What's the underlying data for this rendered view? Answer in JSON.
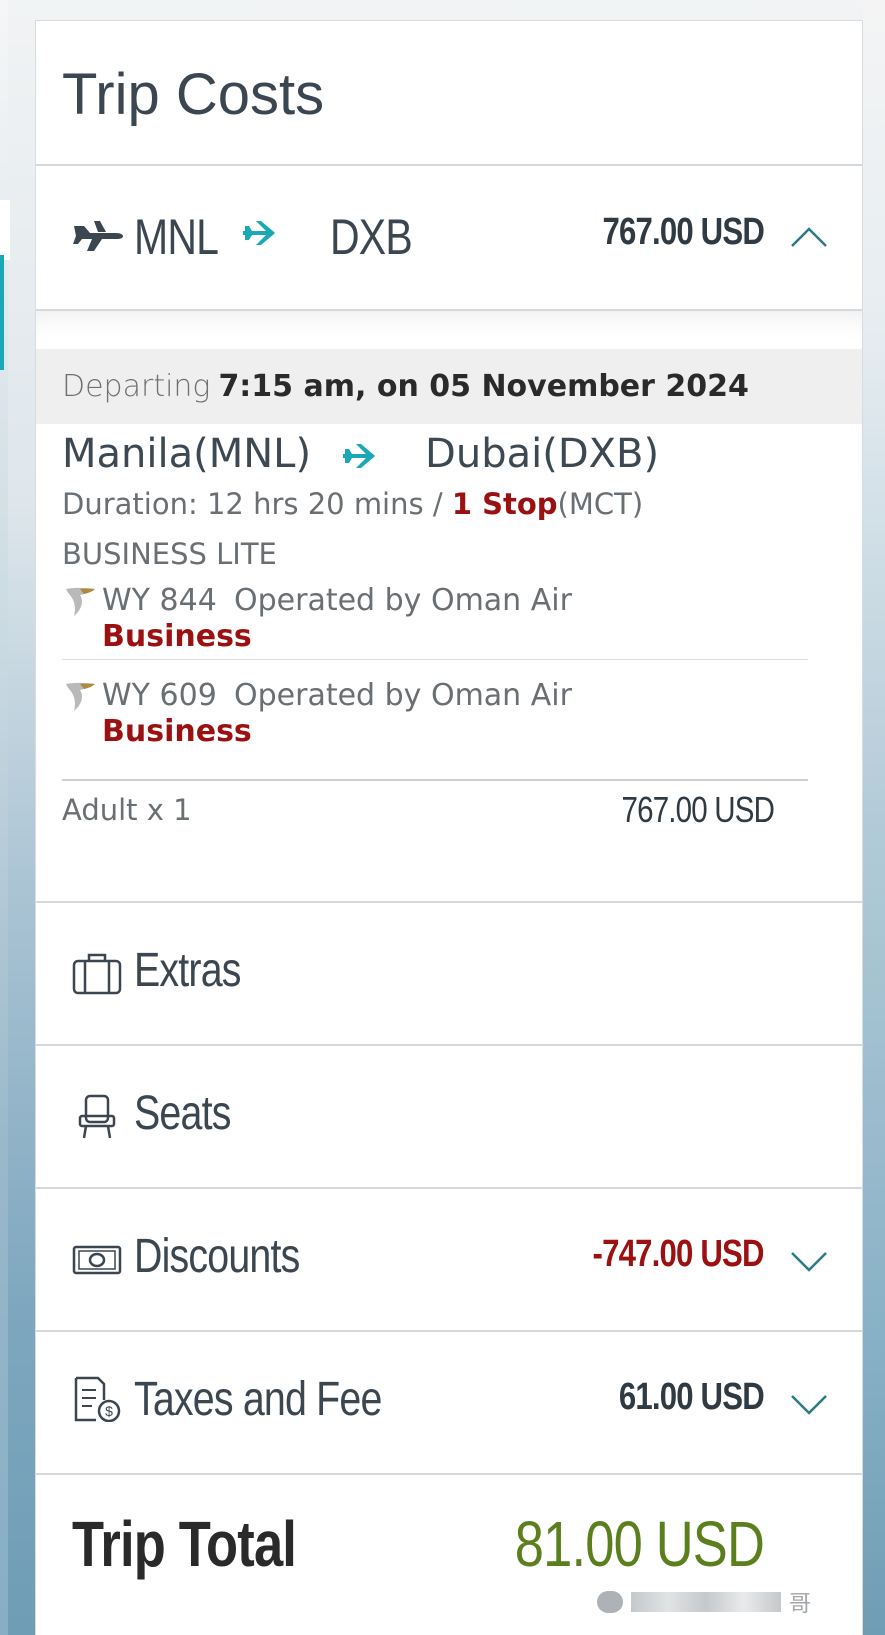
{
  "page": {
    "title": "Trip Costs"
  },
  "flight": {
    "origin_code": "MNL",
    "destination_code": "DXB",
    "price": "767.00 USD",
    "departing_label": "Departing",
    "departing_value": "7:15 am, on 05 November 2024",
    "origin_full": "Manila(MNL)",
    "destination_full": "Dubai(DXB)",
    "duration_text": "Duration: 12 hrs 20 mins / ",
    "stop_text": "1 Stop",
    "stop_via": "(MCT)",
    "fare_family": "BUSINESS LITE",
    "segments": [
      {
        "flight_no": "WY 844",
        "operated_by": "Operated by Oman Air",
        "cabin": "Business"
      },
      {
        "flight_no": "WY 609",
        "operated_by": "Operated by Oman Air",
        "cabin": "Business"
      }
    ],
    "passenger_label": "Adult x 1",
    "passenger_price": "767.00 USD"
  },
  "rows": {
    "extras": {
      "label": "Extras"
    },
    "seats": {
      "label": "Seats"
    },
    "discounts": {
      "label": "Discounts",
      "amount": "-747.00 USD"
    },
    "taxes": {
      "label": "Taxes and Fee",
      "amount": "61.00 USD"
    }
  },
  "total": {
    "label": "Trip Total",
    "amount": "81.00 USD"
  },
  "watermark": {
    "char": "哥"
  },
  "colors": {
    "accent_teal": "#1aa7b6",
    "stop_red": "#9b1010",
    "discount_red": "#9b1010",
    "total_green": "#5b7f1d",
    "text_dark": "#3b4650"
  },
  "icons": {
    "flight": "plane-icon",
    "route_arrow": "plane-arrow-icon",
    "collapse": "chevron-up-icon",
    "expand": "chevron-down-icon",
    "airline": "oman-air-logo-icon",
    "extras": "suitcase-icon",
    "seats": "seat-icon",
    "discounts": "cash-icon",
    "taxes": "receipt-icon"
  }
}
